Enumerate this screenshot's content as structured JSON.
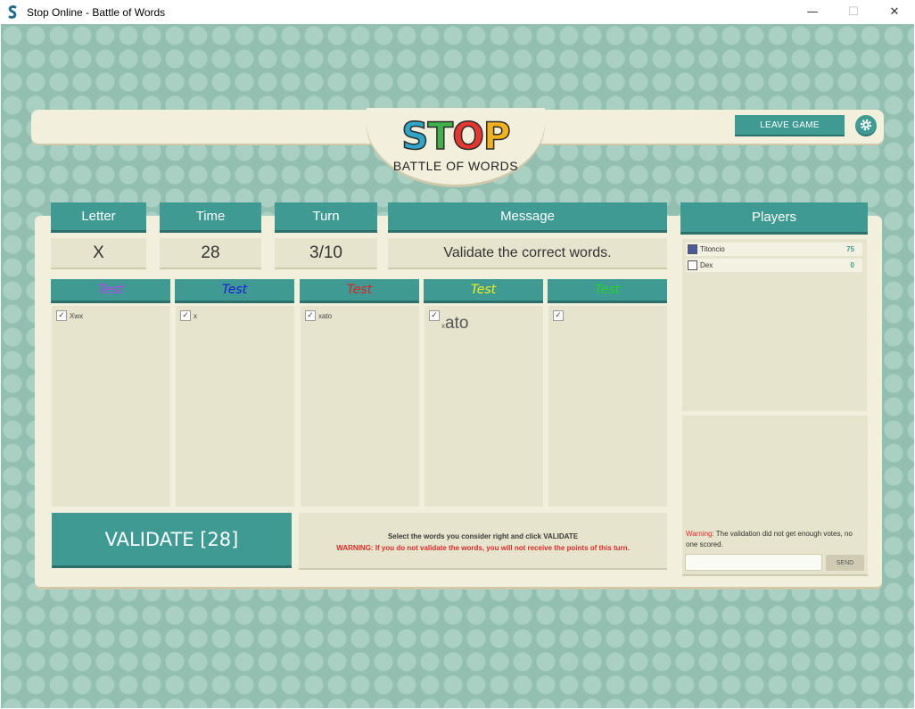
{
  "window": {
    "title": "Stop Online - Battle of Words",
    "minimize_glyph": "—",
    "maximize_glyph": "☐",
    "close_glyph": "✕"
  },
  "header": {
    "logo_title": "STOP",
    "logo_letters": [
      "S",
      "T",
      "O",
      "P"
    ],
    "logo_letter_colors": [
      "#2fa6c8",
      "#3fb24a",
      "#e8352f",
      "#f2b21b"
    ],
    "logo_subtitle": "BATTLE OF WORDS",
    "leave_button": "LEAVE GAME",
    "settings_icon": "gear-icon"
  },
  "status": {
    "letter_label": "Letter",
    "letter_value": "X",
    "time_label": "Time",
    "time_value": "28",
    "turn_label": "Turn",
    "turn_value": "3/10",
    "message_label": "Message",
    "message_value": "Validate the correct words."
  },
  "categories": [
    {
      "name": "Test",
      "color": "#c03ef0",
      "word": "X",
      "word_suffix": "wx",
      "checked": true
    },
    {
      "name": "Test",
      "color": "#1b1bd6",
      "word": "x",
      "checked": true
    },
    {
      "name": "Test",
      "color": "#e02020",
      "word": "xato",
      "checked": true
    },
    {
      "name": "Test",
      "color": "#f2f21b",
      "word_prefix": "x",
      "word": "ato",
      "checked": true
    },
    {
      "name": "Test",
      "color": "#28d428",
      "word": "",
      "checked": true
    }
  ],
  "validate_button": "VALIDATE [28]",
  "info": {
    "instruction": "Select the words you consider right and click VALIDATE",
    "warning": "WARNING: If you do not validate the words, you will not receive the points of this turn."
  },
  "players": {
    "title": "Players",
    "list": [
      {
        "name": "Titoncio",
        "score": "75"
      },
      {
        "name": "Dex",
        "score": "0"
      }
    ]
  },
  "chat": {
    "warning_label": "Warning:",
    "warning_text": " The validation did not get enough votes, no one scored.",
    "input_value": "",
    "send_button": "SEND"
  }
}
